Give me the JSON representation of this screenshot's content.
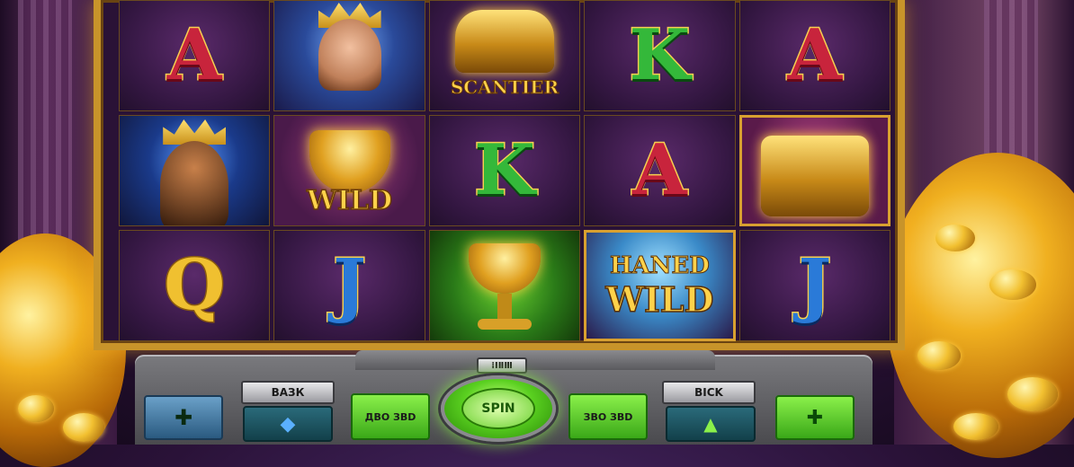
{
  "reels": [
    [
      {
        "symbol": "A",
        "kind": "letter",
        "color": "red"
      },
      {
        "symbol": "king",
        "kind": "portrait"
      },
      {
        "symbol": "Q",
        "kind": "letter",
        "color": "gold"
      }
    ],
    [
      {
        "symbol": "queen",
        "kind": "portrait"
      },
      {
        "symbol": "cup",
        "kind": "wild",
        "label": "WILD"
      },
      {
        "symbol": "J",
        "kind": "letter",
        "color": "blue"
      }
    ],
    [
      {
        "symbol": "chest",
        "kind": "scatter",
        "label": "SCANTIER"
      },
      {
        "symbol": "K",
        "kind": "letter",
        "color": "green"
      },
      {
        "symbol": "trophy",
        "kind": "special"
      }
    ],
    [
      {
        "symbol": "K",
        "kind": "letter",
        "color": "green"
      },
      {
        "symbol": "A",
        "kind": "letter",
        "color": "red"
      },
      {
        "symbol": "hand-wild",
        "kind": "wild",
        "label_top": "HAN̈ED",
        "label": "WILD"
      }
    ],
    [
      {
        "symbol": "A",
        "kind": "letter",
        "color": "red"
      },
      {
        "symbol": "treasure",
        "kind": "special"
      },
      {
        "symbol": "J",
        "kind": "letter",
        "color": "blue"
      }
    ]
  ],
  "labels": {
    "cell_A1": "A",
    "cell_Q": "Q",
    "cell_J2": "J",
    "scatter": "SCANTIER",
    "cell_K3": "K",
    "cell_K4": "K",
    "cell_A4": "A",
    "wild2": "WILD",
    "hand_top": "HANED",
    "hand_wild": "WILD",
    "cell_A5": "A",
    "cell_J5": "J"
  },
  "controls": {
    "top_tag": "⁞ⅠⅡⅢ",
    "left_tag": "ВАЗК",
    "right_tag": "BICK",
    "spin": "SPIN",
    "green_left": "ДВО ЗВD",
    "green_right": "ЗВО ЗВD",
    "plus_glyph": "✚",
    "up_down_glyph": "◆",
    "up_glyph": "▲",
    "plus_right_glyph": "✚"
  },
  "colors": {
    "frame": "#c8942a",
    "spin": "#5ad020",
    "panel": "#6a6a6e"
  }
}
